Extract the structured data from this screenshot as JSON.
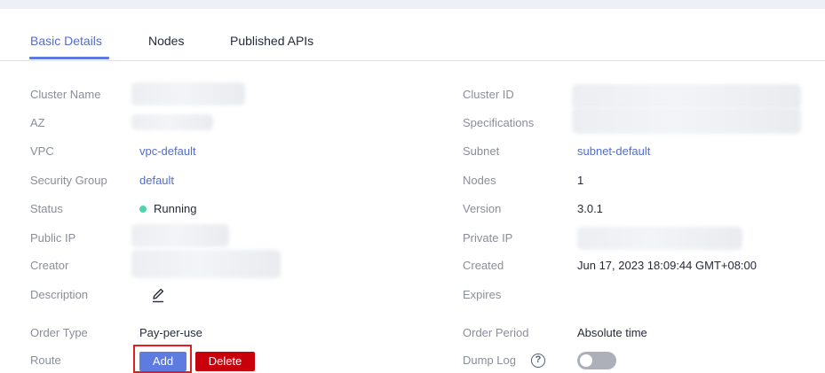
{
  "tabs": [
    {
      "label": "Basic Details",
      "active": true
    },
    {
      "label": "Nodes",
      "active": false
    },
    {
      "label": "Published APIs",
      "active": false
    }
  ],
  "left": {
    "cluster_name_label": "Cluster Name",
    "az_label": "AZ",
    "vpc_label": "VPC",
    "vpc_value": "vpc-default",
    "security_group_label": "Security Group",
    "security_group_value": "default",
    "status_label": "Status",
    "status_value": "Running",
    "public_ip_label": "Public IP",
    "creator_label": "Creator",
    "description_label": "Description",
    "order_type_label": "Order Type",
    "order_type_value": "Pay-per-use",
    "route_label": "Route",
    "add_label": "Add",
    "delete_label": "Delete"
  },
  "right": {
    "cluster_id_label": "Cluster ID",
    "specifications_label": "Specifications",
    "subnet_label": "Subnet",
    "subnet_value": "subnet-default",
    "nodes_label": "Nodes",
    "nodes_value": "1",
    "version_label": "Version",
    "version_value": "3.0.1",
    "private_ip_label": "Private IP",
    "created_label": "Created",
    "created_value": "Jun 17, 2023 18:09:44 GMT+08:00",
    "expires_label": "Expires",
    "order_period_label": "Order Period",
    "order_period_value": "Absolute time",
    "dump_log_label": "Dump Log",
    "dump_log_help": "?",
    "dump_log_enabled": false
  },
  "colors": {
    "accent": "#5e7ce0",
    "link": "#526ecc",
    "danger": "#c7000b",
    "status_running": "#50d4ab",
    "highlight": "#e02020"
  },
  "icons": {
    "description_edit": "pencil-icon",
    "dump_log_help": "help-circle-icon"
  }
}
